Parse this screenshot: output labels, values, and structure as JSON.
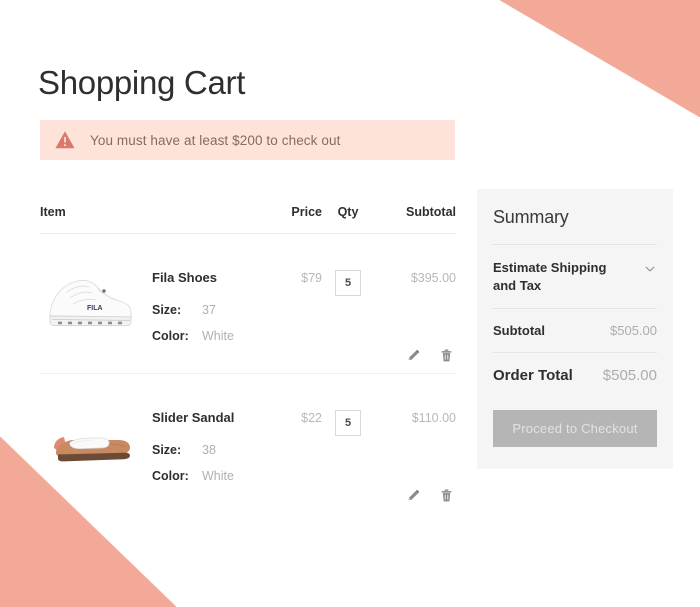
{
  "theme": {
    "accent_salmon": "#f3a998",
    "alert_bg": "#fde3d9",
    "alert_text": "#8a6a60",
    "alert_icon": "#d9796a",
    "summary_bg": "#f5f5f5",
    "button_disabled_bg": "#b5b5b5",
    "muted_text": "#b8b8b8"
  },
  "page": {
    "title": "Shopping Cart"
  },
  "alert": {
    "icon": "warning-triangle-icon",
    "message": "You must have at least $200 to check out"
  },
  "cart": {
    "columns": {
      "item": "Item",
      "price": "Price",
      "qty": "Qty",
      "subtotal": "Subtotal"
    },
    "rows": [
      {
        "image": "white-fila-sneaker",
        "name": "Fila Shoes",
        "size_label": "Size:",
        "size_value": "37",
        "color_label": "Color:",
        "color_value": "White",
        "price": "$79",
        "qty": "5",
        "subtotal": "$395.00",
        "edit_icon": "pencil-icon",
        "delete_icon": "trash-icon"
      },
      {
        "image": "white-slider-sandal",
        "name": "Slider Sandal",
        "size_label": "Size:",
        "size_value": "38",
        "color_label": "Color:",
        "color_value": "White",
        "price": "$22",
        "qty": "5",
        "subtotal": "$110.00",
        "edit_icon": "pencil-icon",
        "delete_icon": "trash-icon"
      }
    ]
  },
  "summary": {
    "title": "Summary",
    "estimate_label": "Estimate Shipping and Tax",
    "estimate_chevron": "chevron-down-icon",
    "subtotal_label": "Subtotal",
    "subtotal_value": "$505.00",
    "total_label": "Order Total",
    "total_value": "$505.00",
    "checkout_label": "Proceed to Checkout"
  }
}
